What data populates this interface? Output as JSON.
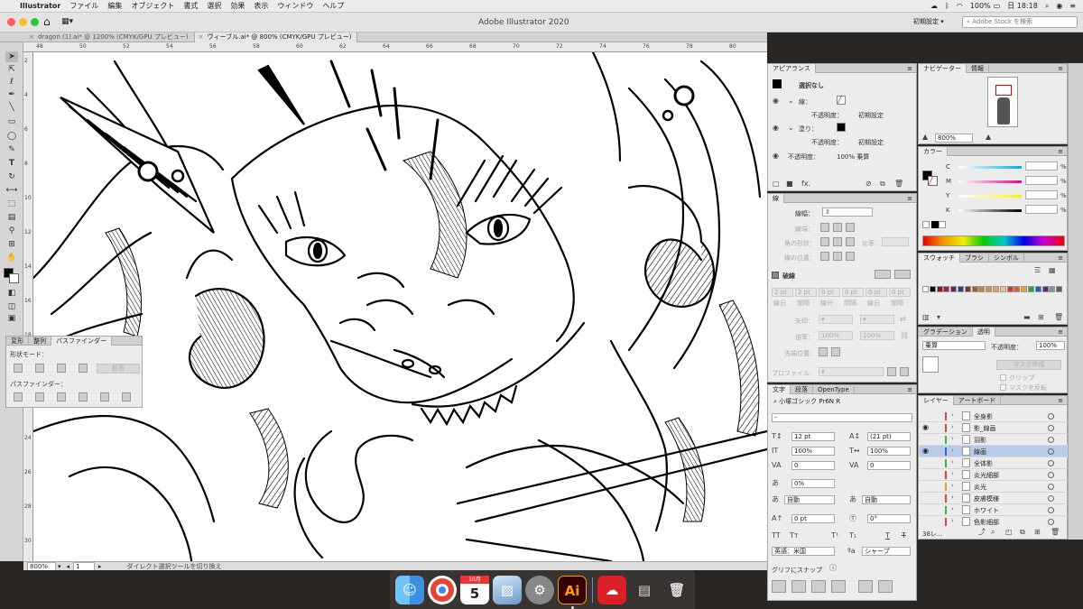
{
  "menubar": {
    "items": [
      "Illustrator",
      "ファイル",
      "編集",
      "オブジェクト",
      "書式",
      "選択",
      "効果",
      "表示",
      "ウィンドウ",
      "ヘルプ"
    ],
    "battery": "100%",
    "clock": "日 18:18"
  },
  "titlebar": {
    "title": "Adobe Illustrator 2020",
    "workspace": "初期設定",
    "stock_placeholder": "Adobe Stock を検索"
  },
  "tabs": [
    {
      "label": "dragon (1).ai* @ 1200% (CMYK/GPU プレビュー)"
    },
    {
      "label": "ヴィーブル.ai* @ 800% (CMYK/GPU プレビュー)"
    }
  ],
  "ruler": {
    "h_ticks": [
      "48",
      "50",
      "52",
      "54",
      "56",
      "58",
      "60",
      "62",
      "64",
      "66",
      "68",
      "70",
      "72",
      "74",
      "76",
      "78",
      "80"
    ],
    "v_ticks": [
      "2",
      "4",
      "6",
      "8",
      "10",
      "12",
      "14",
      "16",
      "18",
      "20",
      "22",
      "24",
      "26",
      "28",
      "30"
    ]
  },
  "status": {
    "zoom": "800%",
    "page": "1",
    "tool_hint": "ダイレクト選択ツールを切り換え"
  },
  "pathfinder": {
    "tabs": [
      "変形",
      "整列",
      "パスファインダー"
    ],
    "shape_mode_label": "形状モード：",
    "expand_label": "拡張",
    "pathfinder_label": "パスファインダー："
  },
  "appearance": {
    "tab": "アピアランス",
    "selection": "選択なし",
    "stroke_label": "線：",
    "opacity_label": "不透明度：",
    "opacity_value": "初期設定",
    "fill_label": "塗り：",
    "fill_opacity_value": "初期設定",
    "object_opacity": "100% 乗算"
  },
  "stroke": {
    "tab": "線",
    "weight_label": "線幅：",
    "cap_label": "線端：",
    "corner_label": "角の形状：",
    "limit_label": "比率：",
    "align_label": "線の位置：",
    "dashed_label": "破線",
    "dash_values": [
      "2 pt",
      "2 pt",
      "0 pt",
      "0 pt",
      "0 pt",
      "0 pt"
    ],
    "dash_captions": [
      "線分",
      "間隔",
      "線分",
      "間隔",
      "線分",
      "間隔"
    ],
    "arrow_label": "矢印：",
    "scale_label": "倍率：",
    "scale_values": [
      "100%",
      "100%"
    ],
    "arrow_pos_label": "先端位置：",
    "profile_label": "プロファイル："
  },
  "character": {
    "tabs": [
      "文字",
      "段落",
      "OpenType"
    ],
    "font": "小塚ゴシック Pr6N R",
    "style": "-",
    "size": "12 pt",
    "leading": "(21 pt)",
    "h_scale": "100%",
    "v_scale": "100%",
    "kerning": "0",
    "tracking": "0",
    "tsume": "0%",
    "aki_left": "自動",
    "aki_right": "自動",
    "baseline": "0 pt",
    "rotation": "0°",
    "language": "英語：米国",
    "antialias": "シャープ",
    "snap_label": "グリフにスナップ"
  },
  "navigator": {
    "tabs": [
      "ナビゲーター",
      "情報"
    ],
    "zoom": "800%"
  },
  "color": {
    "tab": "カラー",
    "channels": [
      {
        "label": "C",
        "unit": "%"
      },
      {
        "label": "M",
        "unit": "%"
      },
      {
        "label": "Y",
        "unit": "%"
      },
      {
        "label": "K",
        "unit": "%"
      }
    ]
  },
  "swatches": {
    "tabs": [
      "スウォッチ",
      "ブラシ",
      "シンボル"
    ],
    "colors": [
      "#ffffff",
      "#000000",
      "#8b1a1a",
      "#a02040",
      "#5a2a6a",
      "#3a3a80",
      "#6b4226",
      "#a06030",
      "#c08040",
      "#d09050",
      "#e0a060",
      "#f0c080",
      "#e03030",
      "#e06030",
      "#f0a020",
      "#30a040",
      "#2060c0",
      "#602080",
      "#909090",
      "#606060"
    ]
  },
  "gradient": {
    "tabs": [
      "グラデーション",
      "透明"
    ],
    "blend": "乗算",
    "opacity_label": "不透明度：",
    "opacity": "100%",
    "make_mask": "マスク作成",
    "clip": "クリップ",
    "invert": "マスクを反転"
  },
  "layers": {
    "tabs": [
      "レイヤー",
      "アートボード"
    ],
    "count": "38レ...",
    "items": [
      {
        "name": "全身影",
        "color": "#e04040",
        "visible": false,
        "selected": false
      },
      {
        "name": "影_線画",
        "color": "#e04040",
        "visible": true,
        "selected": false
      },
      {
        "name": "羽影",
        "color": "#40b040",
        "visible": false,
        "selected": false
      },
      {
        "name": "線画",
        "color": "#4060e0",
        "visible": true,
        "selected": true
      },
      {
        "name": "全体影",
        "color": "#40b040",
        "visible": false,
        "selected": false
      },
      {
        "name": "炎光細部",
        "color": "#e04040",
        "visible": false,
        "selected": false
      },
      {
        "name": "炎光",
        "color": "#e0a020",
        "visible": false,
        "selected": false
      },
      {
        "name": "皮膚模様",
        "color": "#e04040",
        "visible": false,
        "selected": false
      },
      {
        "name": "ホワイト",
        "color": "#40b040",
        "visible": false,
        "selected": false
      },
      {
        "name": "色影細部",
        "color": "#e04040",
        "visible": false,
        "selected": false
      }
    ]
  },
  "dock": {
    "calendar_month": "10月",
    "calendar_day": "5",
    "ai_label": "Ai",
    "apps": [
      "Finder",
      "Chrome",
      "カレンダー",
      "プレビュー",
      "システム環境設定",
      "Illustrator",
      "Creative Cloud",
      "書類",
      "ゴミ箱"
    ]
  }
}
